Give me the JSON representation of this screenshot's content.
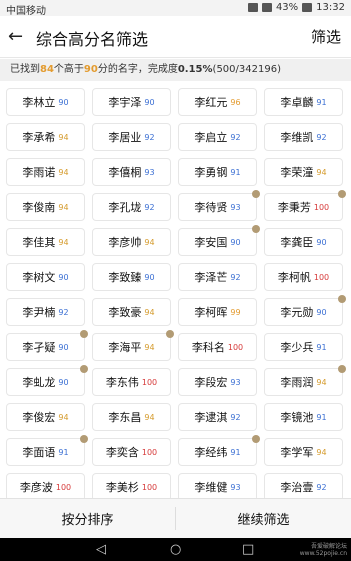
{
  "status": {
    "carrier": "中国移动",
    "battery": "43%",
    "time": "13:32"
  },
  "header": {
    "back_icon": "arrow-left-icon",
    "title": "综合高分名筛选",
    "filter_label": "筛选"
  },
  "summary": {
    "prefix": "已找到",
    "count": "84",
    "mid1": "个高于",
    "threshold": "90",
    "mid2": "分的名字，完成度",
    "percent": "0.15%",
    "progress": "(500/342196)"
  },
  "names": [
    {
      "name": "李林立",
      "score": "90",
      "color": "#3b6fd3"
    },
    {
      "name": "李宇泽",
      "score": "90",
      "color": "#3b6fd3"
    },
    {
      "name": "李红元",
      "score": "96",
      "color": "#e39b2f"
    },
    {
      "name": "李卓麟",
      "score": "91",
      "color": "#3b6fd3"
    },
    {
      "name": "李承希",
      "score": "94",
      "color": "#d59b2c"
    },
    {
      "name": "李居业",
      "score": "92",
      "color": "#3b6fd3"
    },
    {
      "name": "李启立",
      "score": "92",
      "color": "#3b6fd3"
    },
    {
      "name": "李维凯",
      "score": "92",
      "color": "#3b6fd3"
    },
    {
      "name": "李雨诺",
      "score": "94",
      "color": "#d59b2c"
    },
    {
      "name": "李僖桐",
      "score": "93",
      "color": "#3b6fd3"
    },
    {
      "name": "李勇钢",
      "score": "91",
      "color": "#3b6fd3"
    },
    {
      "name": "李荣潼",
      "score": "94",
      "color": "#d59b2c"
    },
    {
      "name": "李俊南",
      "score": "94",
      "color": "#d59b2c"
    },
    {
      "name": "李孔垅",
      "score": "92",
      "color": "#3b6fd3"
    },
    {
      "name": "李待贤",
      "score": "93",
      "color": "#3b6fd3",
      "badge": true
    },
    {
      "name": "李秉芳",
      "score": "100",
      "color": "#d63a3a",
      "badge": true
    },
    {
      "name": "李佳其",
      "score": "94",
      "color": "#d59b2c"
    },
    {
      "name": "李彦帅",
      "score": "94",
      "color": "#d59b2c"
    },
    {
      "name": "李安国",
      "score": "90",
      "color": "#3b6fd3",
      "badge": true
    },
    {
      "name": "李龚臣",
      "score": "90",
      "color": "#3b6fd3"
    },
    {
      "name": "李树文",
      "score": "90",
      "color": "#3b6fd3"
    },
    {
      "name": "李致臻",
      "score": "90",
      "color": "#3b6fd3"
    },
    {
      "name": "李泽芒",
      "score": "92",
      "color": "#3b6fd3"
    },
    {
      "name": "李柯帆",
      "score": "100",
      "color": "#d63a3a"
    },
    {
      "name": "李尹楠",
      "score": "92",
      "color": "#3b6fd3"
    },
    {
      "name": "李致豪",
      "score": "94",
      "color": "#d59b2c"
    },
    {
      "name": "李柯晖",
      "score": "99",
      "color": "#e39b2f"
    },
    {
      "name": "李元勋",
      "score": "90",
      "color": "#3b6fd3",
      "badge": true
    },
    {
      "name": "李孑疑",
      "score": "90",
      "color": "#3b6fd3",
      "badge": true
    },
    {
      "name": "李海平",
      "score": "94",
      "color": "#d59b2c",
      "badge": true
    },
    {
      "name": "李科名",
      "score": "100",
      "color": "#d63a3a"
    },
    {
      "name": "李少兵",
      "score": "91",
      "color": "#3b6fd3"
    },
    {
      "name": "李虬龙",
      "score": "90",
      "color": "#3b6fd3",
      "badge": true
    },
    {
      "name": "李东伟",
      "score": "100",
      "color": "#d63a3a"
    },
    {
      "name": "李段宏",
      "score": "93",
      "color": "#3b6fd3"
    },
    {
      "name": "李雨润",
      "score": "94",
      "color": "#d59b2c",
      "badge": true
    },
    {
      "name": "李俊宏",
      "score": "94",
      "color": "#d59b2c"
    },
    {
      "name": "李东昌",
      "score": "94",
      "color": "#d59b2c"
    },
    {
      "name": "李逮淇",
      "score": "92",
      "color": "#3b6fd3"
    },
    {
      "name": "李镜池",
      "score": "91",
      "color": "#3b6fd3"
    },
    {
      "name": "李面语",
      "score": "91",
      "color": "#3b6fd3",
      "badge": true
    },
    {
      "name": "李奕含",
      "score": "100",
      "color": "#d63a3a"
    },
    {
      "name": "李经纬",
      "score": "91",
      "color": "#3b6fd3",
      "badge": true
    },
    {
      "name": "李学军",
      "score": "94",
      "color": "#d59b2c"
    },
    {
      "name": "李彦波",
      "score": "100",
      "color": "#d63a3a"
    },
    {
      "name": "李美杉",
      "score": "100",
      "color": "#d63a3a"
    },
    {
      "name": "李维健",
      "score": "93",
      "color": "#3b6fd3"
    },
    {
      "name": "李治壹",
      "score": "92",
      "color": "#3b6fd3"
    }
  ],
  "bottom": {
    "sort_label": "按分排序",
    "continue_label": "继续筛选"
  },
  "navbar": {
    "watermark_line1": "吾爱破解论坛",
    "watermark_line2": "www.52pojie.cn"
  }
}
